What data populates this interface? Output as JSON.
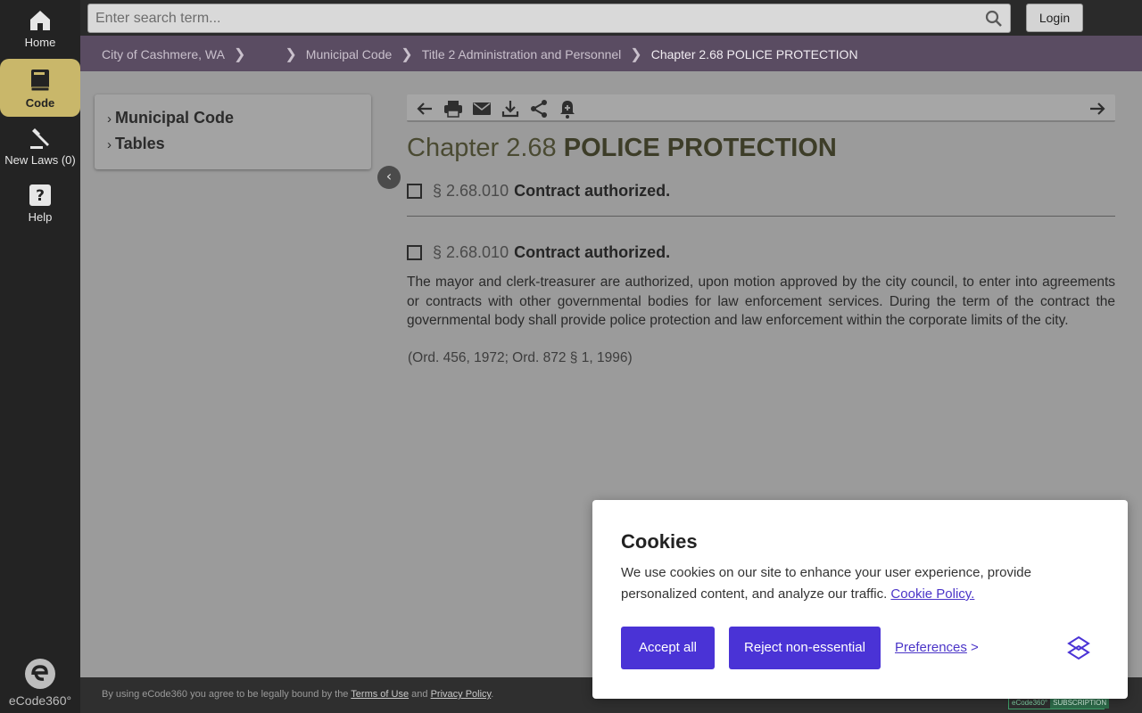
{
  "nav": {
    "home": "Home",
    "code": "Code",
    "new_laws": "New Laws (0)",
    "help": "Help",
    "logo_text": "eCode360°"
  },
  "search": {
    "placeholder": "Enter search term..."
  },
  "login_label": "Login",
  "breadcrumb": {
    "items": [
      "City of Cashmere, WA",
      "Municipal Code",
      "Title 2 Administration and Personnel"
    ],
    "current": "Chapter 2.68 POLICE PROTECTION"
  },
  "toc": {
    "items": [
      "Municipal Code",
      "Tables"
    ]
  },
  "chapter": {
    "prefix": "Chapter 2.68",
    "title": "POLICE PROTECTION"
  },
  "sections": [
    {
      "number": "§ 2.68.010",
      "title": "Contract authorized."
    },
    {
      "number": "§ 2.68.010",
      "title": "Contract authorized."
    }
  ],
  "body_text": "The mayor and clerk-treasurer are authorized, upon motion approved by the city council, to enter into agreements or contracts with other governmental bodies for law enforcement services. During the term of the contract the governmental body shall provide police protection and law enforcement within the corporate limits of the city.",
  "history": "(Ord. 456, 1972; Ord. 872 § 1, 1996)",
  "footer": {
    "prefix": "By using eCode360 you agree to be legally bound by the",
    "terms": "Terms of Use",
    "and": "and",
    "privacy": "Privacy Policy",
    "suffix": ".",
    "badge_left": "eCode360°",
    "badge_right": "SUBSCRIPTION"
  },
  "cookie": {
    "title": "Cookies",
    "text": "We use cookies on our site to enhance your user experience, provide personalized content, and analyze our traffic.",
    "policy_link": "Cookie Policy.",
    "accept": "Accept all",
    "reject": "Reject non-essential",
    "preferences": "Preferences",
    "preferences_arrow": ">"
  },
  "colors": {
    "accent": "#4a33d6",
    "nav_active": "#c9b76a",
    "breadcrumb_bg": "#5a4c62"
  }
}
